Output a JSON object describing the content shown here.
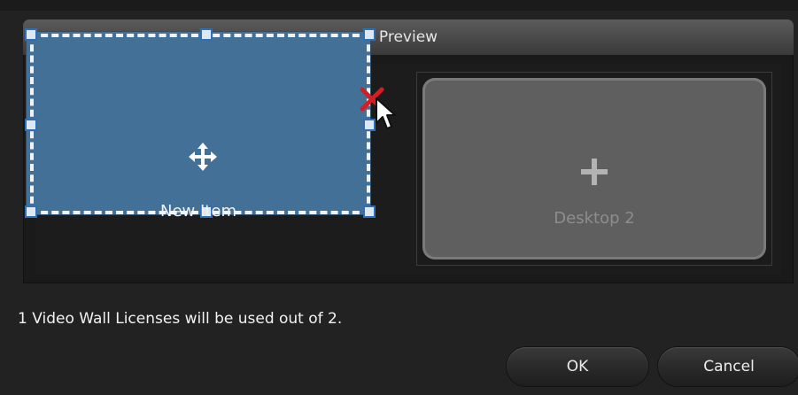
{
  "dialog": {
    "preview_title": "Preview",
    "footer_message": "1 Video Wall Licenses will be used out of 2.",
    "ok_label": "OK",
    "cancel_label": "Cancel"
  },
  "preview": {
    "items": [
      {
        "label": "New Item",
        "icon": "move-icon",
        "color": "#437096",
        "selected": true,
        "remove_icon": "close-icon"
      },
      {
        "label": "Desktop 2",
        "icon": "plus-icon",
        "color": "#5f5f5f",
        "selected": false
      }
    ]
  },
  "colors": {
    "selection_handle": "#2f6fb5",
    "remove_x": "#d21f26"
  }
}
